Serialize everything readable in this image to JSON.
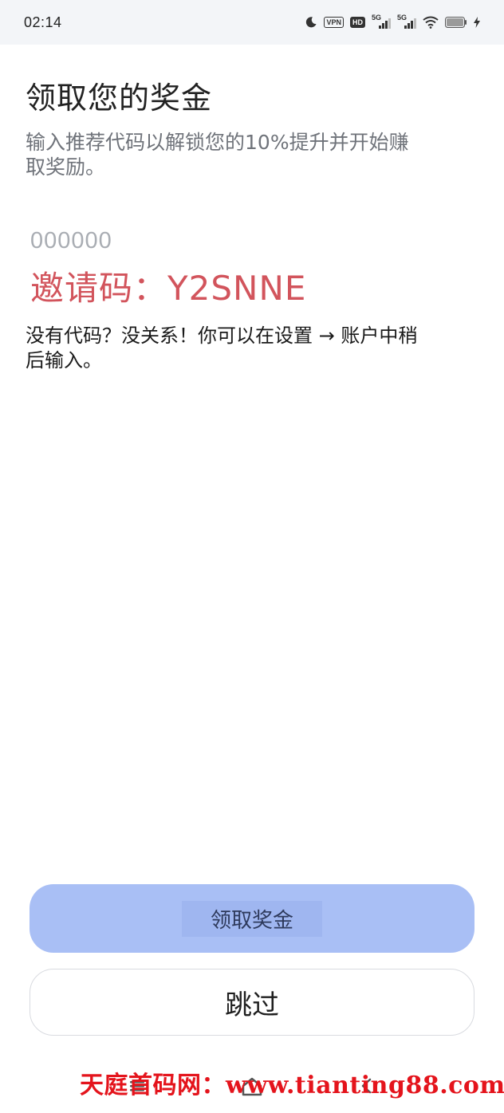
{
  "status_bar": {
    "time": "02:14",
    "vpn_badge": "VPN",
    "hd_badge": "HD",
    "signal_1_label": "5G",
    "signal_2_label": "5G",
    "icons": [
      "moon-icon",
      "vpn-icon",
      "hd-icon",
      "signal-5g-icon",
      "signal-5g-icon",
      "wifi-icon",
      "battery-icon",
      "charging-icon"
    ]
  },
  "header": {
    "title": "领取您的奖金",
    "subtitle": "输入推荐代码以解锁您的10%提升并开始赚取奖励。"
  },
  "referral_input": {
    "value": "",
    "placeholder": "000000"
  },
  "invite_code_text": "邀请码：Y2SNNE",
  "hint": "没有代码？没关系！你可以在设置 → 账户中稍后输入。",
  "buttons": {
    "claim_label": "领取奖金",
    "skip_label": "跳过"
  },
  "watermark": "天庭首码网：www.tianting88.com",
  "colors": {
    "primary_button": "#a9bff5",
    "invite_code": "#d2545c",
    "watermark": "#e4141c",
    "subtitle_text": "#6f737a"
  }
}
